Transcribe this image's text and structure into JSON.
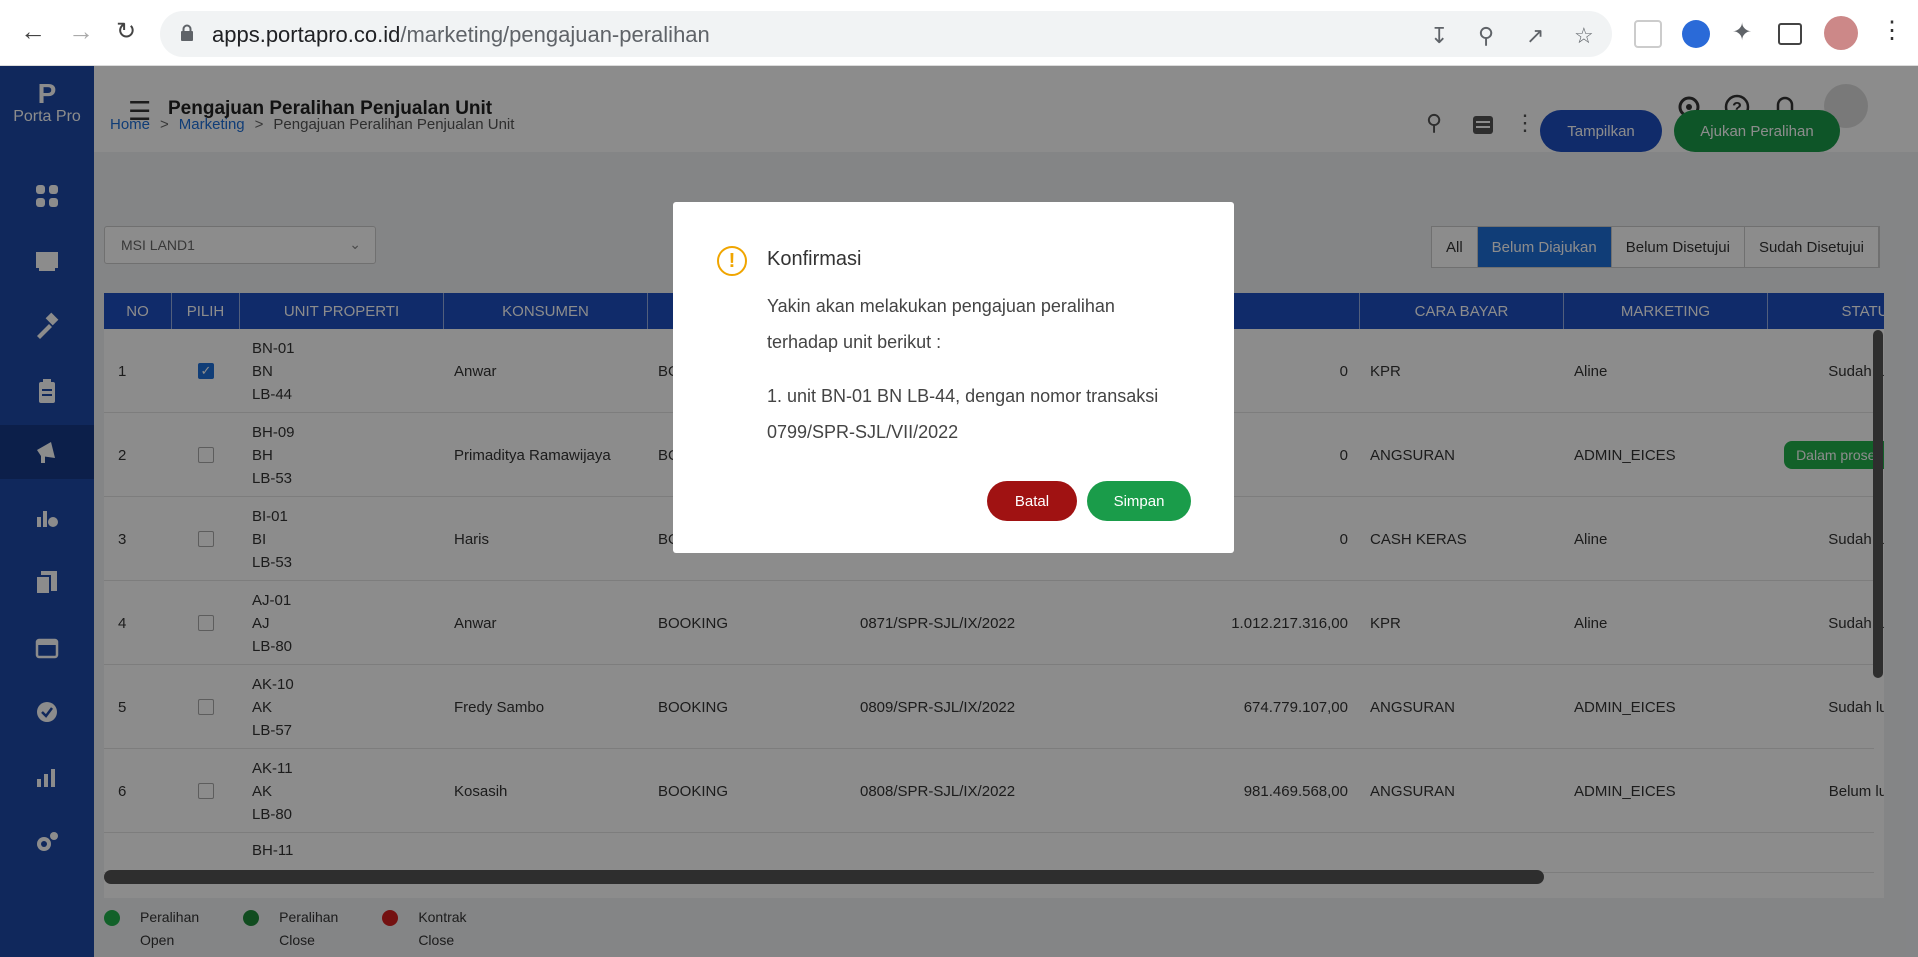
{
  "browser": {
    "url_host": "apps.portapro.co.id",
    "url_path": "/marketing/pengajuan-peralihan"
  },
  "sidebar": {
    "logo_letter": "P",
    "logo_text": "Porta Pro"
  },
  "header": {
    "page_title": "Pengajuan Peralihan Penjualan Unit"
  },
  "breadcrumb": {
    "home": "Home",
    "marketing": "Marketing",
    "current": "Pengajuan Peralihan Penjualan Unit",
    "sep": ">"
  },
  "toolbar": {
    "tampilkan_label": "Tampilkan",
    "ajukan_label": "Ajukan Peralihan"
  },
  "select": {
    "value": "MSI LAND1"
  },
  "filters": [
    "All",
    "Belum Diajukan",
    "Belum Disetujui",
    "Sudah Disetujui"
  ],
  "table": {
    "headers": {
      "no": "NO",
      "pilih": "PILIH",
      "unit": "UNIT PROPERTI",
      "konsumen": "KONSUMEN",
      "cara_bayar": "CARA BAYAR",
      "marketing": "MARKETING",
      "status": "STATUS"
    },
    "rows": [
      {
        "no": "1",
        "unit1": "BN-01",
        "unit2": "BN",
        "unit3": "LB-44",
        "konsumen": "Anwar",
        "jenis": "BO",
        "transaksi": "",
        "nilai": "0",
        "cara": "KPR",
        "marketing": "Aline",
        "status": "Sudah lunas"
      },
      {
        "no": "2",
        "unit1": "BH-09",
        "unit2": "BH",
        "unit3": "LB-53",
        "konsumen": "Primaditya Ramawijaya",
        "jenis": "BO",
        "transaksi": "",
        "nilai": "0",
        "cara": "ANGSURAN",
        "marketing": "ADMIN_EICES",
        "status": "Dalam proses peralihan"
      },
      {
        "no": "3",
        "unit1": "BI-01",
        "unit2": "BI",
        "unit3": "LB-53",
        "konsumen": "Haris",
        "jenis": "BO",
        "transaksi": "",
        "nilai": "0",
        "cara": "CASH KERAS",
        "marketing": "Aline",
        "status": "Sudah lunas"
      },
      {
        "no": "4",
        "unit1": "AJ-01",
        "unit2": "AJ",
        "unit3": "LB-80",
        "konsumen": "Anwar",
        "jenis": "BOOKING",
        "transaksi": "0871/SPR-SJL/IX/2022",
        "nilai": "1.012.217.316,00",
        "cara": "KPR",
        "marketing": "Aline",
        "status": "Sudah lunas"
      },
      {
        "no": "5",
        "unit1": "AK-10",
        "unit2": "AK",
        "unit3": "LB-57",
        "konsumen": "Fredy Sambo",
        "jenis": "BOOKING",
        "transaksi": "0809/SPR-SJL/IX/2022",
        "nilai": "674.779.107,00",
        "cara": "ANGSURAN",
        "marketing": "ADMIN_EICES",
        "status": "Sudah lunas"
      },
      {
        "no": "6",
        "unit1": "AK-11",
        "unit2": "AK",
        "unit3": "LB-80",
        "konsumen": "Kosasih",
        "jenis": "BOOKING",
        "transaksi": "0808/SPR-SJL/IX/2022",
        "nilai": "981.469.568,00",
        "cara": "ANGSURAN",
        "marketing": "ADMIN_EICES",
        "status": "Belum lunas"
      },
      {
        "no": "",
        "unit1": "BH-11",
        "unit2": "",
        "unit3": "",
        "konsumen": "",
        "jenis": "",
        "transaksi": "",
        "nilai": "",
        "cara": "",
        "marketing": "",
        "status": ""
      }
    ]
  },
  "legend": [
    {
      "l1": "Peralihan",
      "l2": "Open",
      "color": "#22b14c"
    },
    {
      "l1": "Peralihan",
      "l2": "Close",
      "color": "#1e8a3a"
    },
    {
      "l1": "Kontrak",
      "l2": "Close",
      "color": "#d42020"
    }
  ],
  "modal": {
    "title": "Konfirmasi",
    "line1": "Yakin akan melakukan pengajuan peralihan",
    "line2": "terhadap unit berikut :",
    "item1": "1. unit BN-01 BN LB-44, dengan nomor transaksi",
    "item2": "0799/SPR-SJL/VII/2022",
    "batal_label": "Batal",
    "simpan_label": "Simpan"
  },
  "colors": {
    "primary": "#1e4fc2",
    "success": "#1a9c4a",
    "danger": "#a01212",
    "sidebar": "#1e4aa8"
  }
}
